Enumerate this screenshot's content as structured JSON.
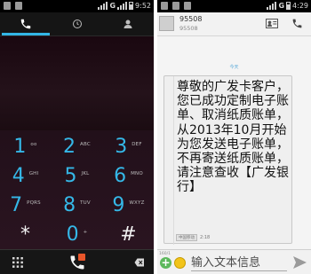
{
  "left": {
    "status_time": "9:52",
    "status_net": "G",
    "keys": [
      {
        "num": "1",
        "sub": "oo"
      },
      {
        "num": "2",
        "sub": "ABC"
      },
      {
        "num": "3",
        "sub": "DEF"
      },
      {
        "num": "4",
        "sub": "GHI"
      },
      {
        "num": "5",
        "sub": "JKL"
      },
      {
        "num": "6",
        "sub": "MNO"
      },
      {
        "num": "7",
        "sub": "PQRS"
      },
      {
        "num": "8",
        "sub": "TUV"
      },
      {
        "num": "9",
        "sub": "WXYZ"
      },
      {
        "num": "*",
        "sub": ""
      },
      {
        "num": "0",
        "sub": "+"
      },
      {
        "num": "#",
        "sub": ""
      }
    ],
    "accent": "#33b5e5"
  },
  "right": {
    "status_time": "4:29",
    "status_net": "G",
    "sender_name": "95508",
    "sender_number": "95508",
    "date_separator": "今天",
    "message_text": "尊敬的广发卡客户，您已成功定制电子账单、取消纸质账单，从2013年10月开始为您发送电子账单，不再寄送纸质账单，请注意查收【广发银行】",
    "message_carrier": "中国移动",
    "message_time": "2:18",
    "char_count": "160/1",
    "compose_placeholder": "输入文本信息"
  }
}
